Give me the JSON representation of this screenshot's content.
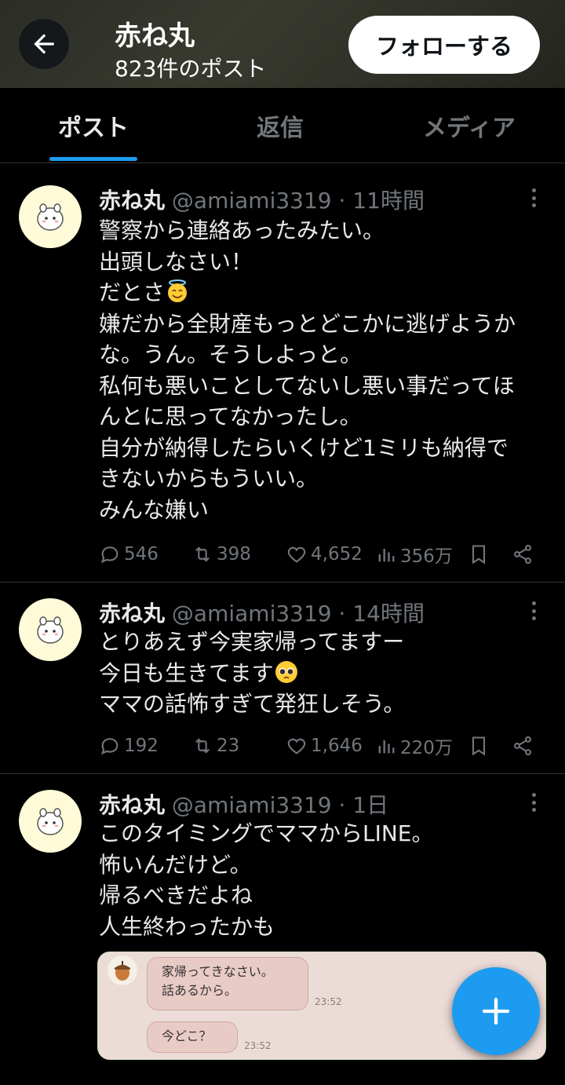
{
  "header": {
    "name": "赤ね丸",
    "post_count": "823件のポスト",
    "follow_label": "フォローする"
  },
  "tabs": [
    {
      "label": "ポスト",
      "active": true
    },
    {
      "label": "返信",
      "active": false
    },
    {
      "label": "メディア",
      "active": false
    }
  ],
  "posts": [
    {
      "name": "赤ね丸",
      "handle": "@amiami3319",
      "time": "11時間",
      "lines": [
        "警察から連絡あったみたい。",
        "出頭しなさい！",
        "だとさ",
        "嫌だから全財産もっとどこかに逃げようか",
        "な。うん。そうしよっと。",
        "私何も悪いことしてないし悪い事だってほ",
        "んとに思ってなかったし。",
        "自分が納得したらいくけど1ミリも納得で",
        "きないからもういい。",
        "みんな嫌い"
      ],
      "emoji": "smiling-face-with-halo",
      "replies": "546",
      "reposts": "398",
      "likes": "4,652",
      "views": "356万"
    },
    {
      "name": "赤ね丸",
      "handle": "@amiami3319",
      "time": "14時間",
      "lines": [
        "とりあえず今実家帰ってますー",
        "今日も生きてます",
        "ママの話怖すぎて発狂しそう。"
      ],
      "emoji": "pleading-face",
      "replies": "192",
      "reposts": "23",
      "likes": "1,646",
      "views": "220万"
    },
    {
      "name": "赤ね丸",
      "handle": "@amiami3319",
      "time": "1日",
      "lines": [
        "このタイミングでママからLINE。",
        "怖いんだけど。",
        "帰るべきだよね",
        "人生終わったかも"
      ],
      "image": {
        "bubble1_line1": "家帰ってきなさい。",
        "bubble1_line2": "話あるから。",
        "bubble1_time": "23:52",
        "bubble2": "今どこ？",
        "bubble2_time": "23:52"
      }
    }
  ],
  "colors": {
    "accent": "#1d9bf0",
    "background": "#000000",
    "secondary_text": "#71767b",
    "divider": "#2f3336"
  }
}
